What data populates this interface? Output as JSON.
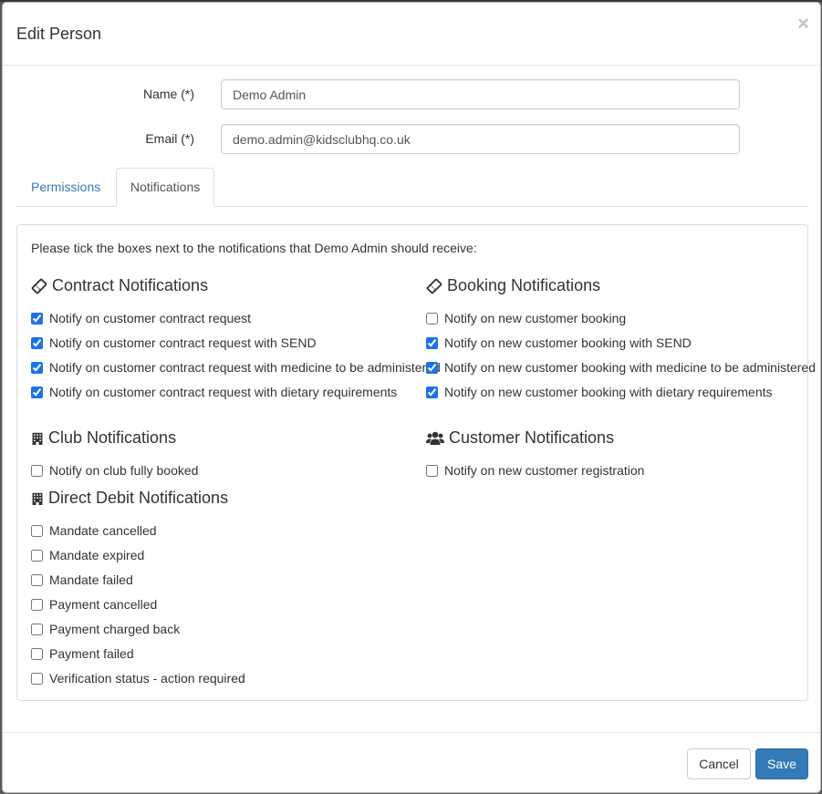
{
  "modal": {
    "title": "Edit Person",
    "close_glyph": "×"
  },
  "form": {
    "name_label": "Name (*)",
    "name_value": "Demo Admin",
    "email_label": "Email (*)",
    "email_value": "demo.admin@kidsclubhq.co.uk"
  },
  "tabs": [
    {
      "label": "Permissions",
      "active": false
    },
    {
      "label": "Notifications",
      "active": true
    }
  ],
  "notifications": {
    "intro": "Please tick the boxes next to the notifications that Demo Admin should receive:",
    "contract": {
      "title": "Contract Notifications",
      "icon": "ticket-icon",
      "items": [
        {
          "label": "Notify on customer contract request",
          "checked": true
        },
        {
          "label": "Notify on customer contract request with SEND",
          "checked": true
        },
        {
          "label": "Notify on customer contract request with medicine to be administered",
          "checked": true
        },
        {
          "label": "Notify on customer contract request with dietary requirements",
          "checked": true
        }
      ]
    },
    "booking": {
      "title": "Booking Notifications",
      "icon": "ticket-icon",
      "items": [
        {
          "label": "Notify on new customer booking",
          "checked": false
        },
        {
          "label": "Notify on new customer booking with SEND",
          "checked": true
        },
        {
          "label": "Notify on new customer booking with medicine to be administered",
          "checked": true
        },
        {
          "label": "Notify on new customer booking with dietary requirements",
          "checked": true
        }
      ]
    },
    "club": {
      "title": "Club Notifications",
      "icon": "building-icon",
      "items": [
        {
          "label": "Notify on club fully booked",
          "checked": false
        }
      ]
    },
    "customer": {
      "title": "Customer Notifications",
      "icon": "users-icon",
      "items": [
        {
          "label": "Notify on new customer registration",
          "checked": false
        }
      ]
    },
    "direct_debit": {
      "title": "Direct Debit Notifications",
      "icon": "building-icon",
      "items": [
        {
          "label": "Mandate cancelled",
          "checked": false
        },
        {
          "label": "Mandate expired",
          "checked": false
        },
        {
          "label": "Mandate failed",
          "checked": false
        },
        {
          "label": "Payment cancelled",
          "checked": false
        },
        {
          "label": "Payment charged back",
          "checked": false
        },
        {
          "label": "Payment failed",
          "checked": false
        },
        {
          "label": "Verification status - action required",
          "checked": false
        }
      ]
    }
  },
  "footer": {
    "cancel_label": "Cancel",
    "save_label": "Save"
  },
  "colors": {
    "primary": "#337ab7",
    "link": "#337ab7",
    "checkbox_checked": "#1a73e8"
  }
}
